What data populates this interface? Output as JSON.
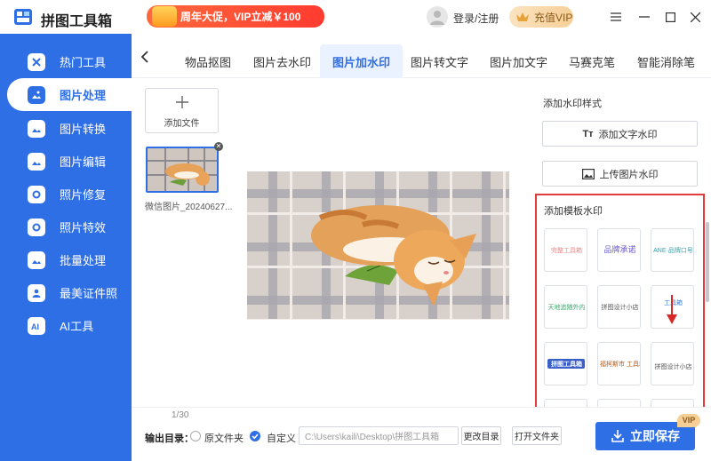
{
  "app": {
    "title": "拼图工具箱"
  },
  "promo": {
    "text": "周年大促，VIP立减￥100"
  },
  "user": {
    "login_label": "登录/注册"
  },
  "vip": {
    "label": "充值VIP"
  },
  "sidebar": {
    "items": [
      {
        "label": "热门工具",
        "icon": "hot-tools-icon"
      },
      {
        "label": "图片处理",
        "icon": "image-process-icon",
        "active": true
      },
      {
        "label": "图片转换",
        "icon": "image-convert-icon"
      },
      {
        "label": "图片编辑",
        "icon": "image-edit-icon"
      },
      {
        "label": "照片修复",
        "icon": "photo-repair-icon"
      },
      {
        "label": "照片特效",
        "icon": "photo-effect-icon"
      },
      {
        "label": "批量处理",
        "icon": "batch-icon"
      },
      {
        "label": "最美证件照",
        "icon": "id-photo-icon"
      },
      {
        "label": "AI工具",
        "icon": "ai-icon"
      }
    ]
  },
  "tabs": [
    {
      "label": "物品抠图"
    },
    {
      "label": "图片去水印"
    },
    {
      "label": "图片加水印",
      "active": true
    },
    {
      "label": "图片转文字"
    },
    {
      "label": "图片加文字"
    },
    {
      "label": "马赛克笔"
    },
    {
      "label": "智能消除笔"
    }
  ],
  "files": {
    "add_label": "添加文件",
    "items": [
      {
        "name": "微信图片_20240627..."
      }
    ],
    "page_count": "1/30"
  },
  "panel": {
    "style_title": "添加水印样式",
    "text_watermark": "添加文字水印",
    "image_watermark": "上传图片水印",
    "template_title": "添加模板水印",
    "templates": [
      {
        "text": "完整工具箱",
        "color": "#e78a8a"
      },
      {
        "text": "品牌承诺",
        "color": "#6a5acd"
      },
      {
        "text": "ANE·品牌口号",
        "color": "#3aa0a8"
      },
      {
        "text": "天地追随外内",
        "color": "#3aa86b"
      },
      {
        "text": "拼图设计小店",
        "color": "#555555"
      },
      {
        "text": "工具箱",
        "color": "#3a7fd0"
      },
      {
        "text": "拼图工具箱",
        "color": "#ffffff"
      },
      {
        "text": "福柯斯市 工具箱名称",
        "color": "#b05a1a"
      },
      {
        "text": "拼图设计小店",
        "color": "#555555"
      },
      {
        "text": "",
        "color": "#333333"
      },
      {
        "text": "",
        "color": "#333333"
      },
      {
        "text": "",
        "color": "#333333"
      }
    ]
  },
  "output": {
    "dir_label": "输出目录：",
    "option_original": "原文件夹",
    "option_custom": "自定义",
    "path": "C:\\Users\\kaili\\Desktop\\拼图工具箱",
    "change_label": "更改目录",
    "open_label": "打开文件夹",
    "save_label": "立即保存",
    "vip_tag": "VIP"
  },
  "colors": {
    "primary": "#2f6fe6",
    "highlight": "#e23b3b",
    "vip": "#f6cf96"
  }
}
